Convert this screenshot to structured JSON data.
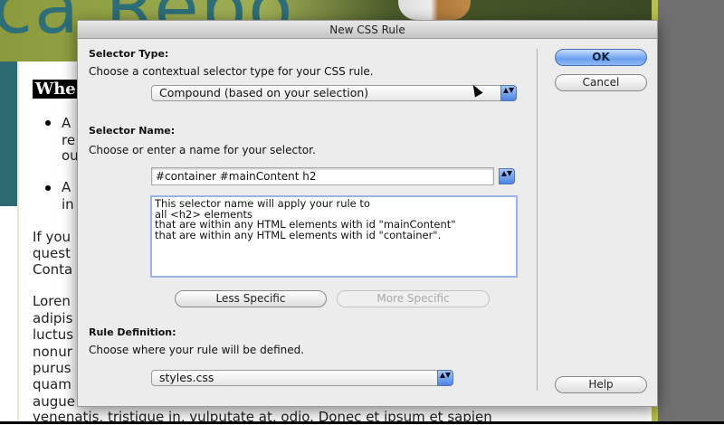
{
  "background": {
    "logo_text": "ca Repo",
    "heading": "Whe",
    "lines": [
      "A",
      "re",
      "ou",
      "A",
      "in",
      "If you",
      "quest",
      "Conta",
      "Loren",
      "adipis",
      "luctus",
      "nonur",
      "purus",
      "quam",
      "augue",
      "venenatis, tristique in, vulputate at, odio. Donec et ipsum et sapien"
    ]
  },
  "dialog": {
    "title": "New CSS Rule",
    "selector_type": {
      "heading": "Selector Type:",
      "instruction": "Choose a contextual selector type for your CSS rule.",
      "value": "Compound (based on your selection)"
    },
    "selector_name": {
      "heading": "Selector Name:",
      "instruction": "Choose or enter a name for your selector.",
      "value": "#container #mainContent h2",
      "description": [
        "This selector name will apply your rule to",
        "all <h2> elements",
        "that are within any HTML elements with id \"mainContent\"",
        "that are within any HTML elements with id \"container\"."
      ]
    },
    "less_specific": "Less Specific",
    "more_specific": "More Specific",
    "rule_definition": {
      "heading": "Rule Definition:",
      "instruction": "Choose where your rule will be defined.",
      "value": "styles.css"
    },
    "ok": "OK",
    "cancel": "Cancel",
    "help": "Help",
    "arrows_glyph": "▲▼"
  }
}
